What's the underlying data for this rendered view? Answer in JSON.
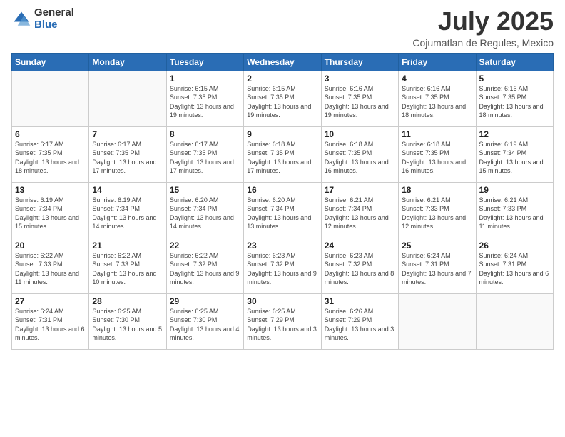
{
  "logo": {
    "general": "General",
    "blue": "Blue"
  },
  "title": "July 2025",
  "subtitle": "Cojumatlan de Regules, Mexico",
  "weekdays": [
    "Sunday",
    "Monday",
    "Tuesday",
    "Wednesday",
    "Thursday",
    "Friday",
    "Saturday"
  ],
  "weeks": [
    [
      {
        "day": "",
        "info": ""
      },
      {
        "day": "",
        "info": ""
      },
      {
        "day": "1",
        "info": "Sunrise: 6:15 AM\nSunset: 7:35 PM\nDaylight: 13 hours and 19 minutes."
      },
      {
        "day": "2",
        "info": "Sunrise: 6:15 AM\nSunset: 7:35 PM\nDaylight: 13 hours and 19 minutes."
      },
      {
        "day": "3",
        "info": "Sunrise: 6:16 AM\nSunset: 7:35 PM\nDaylight: 13 hours and 19 minutes."
      },
      {
        "day": "4",
        "info": "Sunrise: 6:16 AM\nSunset: 7:35 PM\nDaylight: 13 hours and 18 minutes."
      },
      {
        "day": "5",
        "info": "Sunrise: 6:16 AM\nSunset: 7:35 PM\nDaylight: 13 hours and 18 minutes."
      }
    ],
    [
      {
        "day": "6",
        "info": "Sunrise: 6:17 AM\nSunset: 7:35 PM\nDaylight: 13 hours and 18 minutes."
      },
      {
        "day": "7",
        "info": "Sunrise: 6:17 AM\nSunset: 7:35 PM\nDaylight: 13 hours and 17 minutes."
      },
      {
        "day": "8",
        "info": "Sunrise: 6:17 AM\nSunset: 7:35 PM\nDaylight: 13 hours and 17 minutes."
      },
      {
        "day": "9",
        "info": "Sunrise: 6:18 AM\nSunset: 7:35 PM\nDaylight: 13 hours and 17 minutes."
      },
      {
        "day": "10",
        "info": "Sunrise: 6:18 AM\nSunset: 7:35 PM\nDaylight: 13 hours and 16 minutes."
      },
      {
        "day": "11",
        "info": "Sunrise: 6:18 AM\nSunset: 7:35 PM\nDaylight: 13 hours and 16 minutes."
      },
      {
        "day": "12",
        "info": "Sunrise: 6:19 AM\nSunset: 7:34 PM\nDaylight: 13 hours and 15 minutes."
      }
    ],
    [
      {
        "day": "13",
        "info": "Sunrise: 6:19 AM\nSunset: 7:34 PM\nDaylight: 13 hours and 15 minutes."
      },
      {
        "day": "14",
        "info": "Sunrise: 6:19 AM\nSunset: 7:34 PM\nDaylight: 13 hours and 14 minutes."
      },
      {
        "day": "15",
        "info": "Sunrise: 6:20 AM\nSunset: 7:34 PM\nDaylight: 13 hours and 14 minutes."
      },
      {
        "day": "16",
        "info": "Sunrise: 6:20 AM\nSunset: 7:34 PM\nDaylight: 13 hours and 13 minutes."
      },
      {
        "day": "17",
        "info": "Sunrise: 6:21 AM\nSunset: 7:34 PM\nDaylight: 13 hours and 12 minutes."
      },
      {
        "day": "18",
        "info": "Sunrise: 6:21 AM\nSunset: 7:33 PM\nDaylight: 13 hours and 12 minutes."
      },
      {
        "day": "19",
        "info": "Sunrise: 6:21 AM\nSunset: 7:33 PM\nDaylight: 13 hours and 11 minutes."
      }
    ],
    [
      {
        "day": "20",
        "info": "Sunrise: 6:22 AM\nSunset: 7:33 PM\nDaylight: 13 hours and 11 minutes."
      },
      {
        "day": "21",
        "info": "Sunrise: 6:22 AM\nSunset: 7:33 PM\nDaylight: 13 hours and 10 minutes."
      },
      {
        "day": "22",
        "info": "Sunrise: 6:22 AM\nSunset: 7:32 PM\nDaylight: 13 hours and 9 minutes."
      },
      {
        "day": "23",
        "info": "Sunrise: 6:23 AM\nSunset: 7:32 PM\nDaylight: 13 hours and 9 minutes."
      },
      {
        "day": "24",
        "info": "Sunrise: 6:23 AM\nSunset: 7:32 PM\nDaylight: 13 hours and 8 minutes."
      },
      {
        "day": "25",
        "info": "Sunrise: 6:24 AM\nSunset: 7:31 PM\nDaylight: 13 hours and 7 minutes."
      },
      {
        "day": "26",
        "info": "Sunrise: 6:24 AM\nSunset: 7:31 PM\nDaylight: 13 hours and 6 minutes."
      }
    ],
    [
      {
        "day": "27",
        "info": "Sunrise: 6:24 AM\nSunset: 7:31 PM\nDaylight: 13 hours and 6 minutes."
      },
      {
        "day": "28",
        "info": "Sunrise: 6:25 AM\nSunset: 7:30 PM\nDaylight: 13 hours and 5 minutes."
      },
      {
        "day": "29",
        "info": "Sunrise: 6:25 AM\nSunset: 7:30 PM\nDaylight: 13 hours and 4 minutes."
      },
      {
        "day": "30",
        "info": "Sunrise: 6:25 AM\nSunset: 7:29 PM\nDaylight: 13 hours and 3 minutes."
      },
      {
        "day": "31",
        "info": "Sunrise: 6:26 AM\nSunset: 7:29 PM\nDaylight: 13 hours and 3 minutes."
      },
      {
        "day": "",
        "info": ""
      },
      {
        "day": "",
        "info": ""
      }
    ]
  ]
}
